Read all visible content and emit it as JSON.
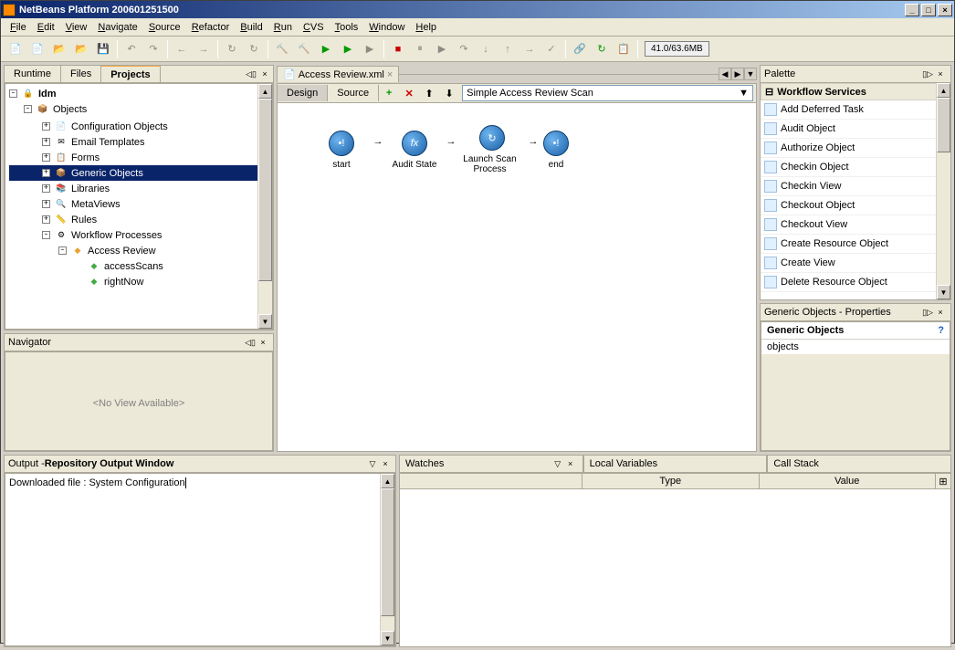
{
  "title": "NetBeans Platform 200601251500",
  "menu": [
    "File",
    "Edit",
    "View",
    "Navigate",
    "Source",
    "Refactor",
    "Build",
    "Run",
    "CVS",
    "Tools",
    "Window",
    "Help"
  ],
  "memory": "41.0/63.6MB",
  "left_tabs": [
    "Runtime",
    "Files",
    "Projects"
  ],
  "tree": {
    "root": "Idm",
    "objects": "Objects",
    "items": [
      "Configuration Objects",
      "Email Templates",
      "Forms",
      "Generic Objects",
      "Libraries",
      "MetaViews",
      "Rules",
      "Workflow Processes"
    ],
    "selected": "Generic Objects",
    "wf_child": "Access Review",
    "wf_leaves": [
      "accessScans",
      "rightNow"
    ]
  },
  "navigator_title": "Navigator",
  "navigator_empty": "<No View Available>",
  "editor_tab": "Access Review.xml",
  "views": [
    "Design",
    "Source"
  ],
  "scan_label": "Simple Access Review Scan",
  "nodes": [
    "start",
    "Audit State",
    "Launch Scan Process",
    "end"
  ],
  "palette_title": "Palette",
  "palette_cat": "Workflow Services",
  "palette_items": [
    "Add Deferred Task",
    "Audit Object",
    "Authorize Object",
    "Checkin Object",
    "Checkin View",
    "Checkout Object",
    "Checkout View",
    "Create Resource Object",
    "Create View",
    "Delete Resource Object"
  ],
  "props_title": "Generic Objects - Properties",
  "props_name": "Generic Objects",
  "props_sub": "objects",
  "output_title": "Output - ",
  "output_title_bold": "Repository Output Window",
  "output_text": "Downloaded file : System Configuration",
  "dbg_tabs": [
    "Watches",
    "Local Variables",
    "Call Stack"
  ],
  "dbg_cols": [
    "Type",
    "Value"
  ]
}
